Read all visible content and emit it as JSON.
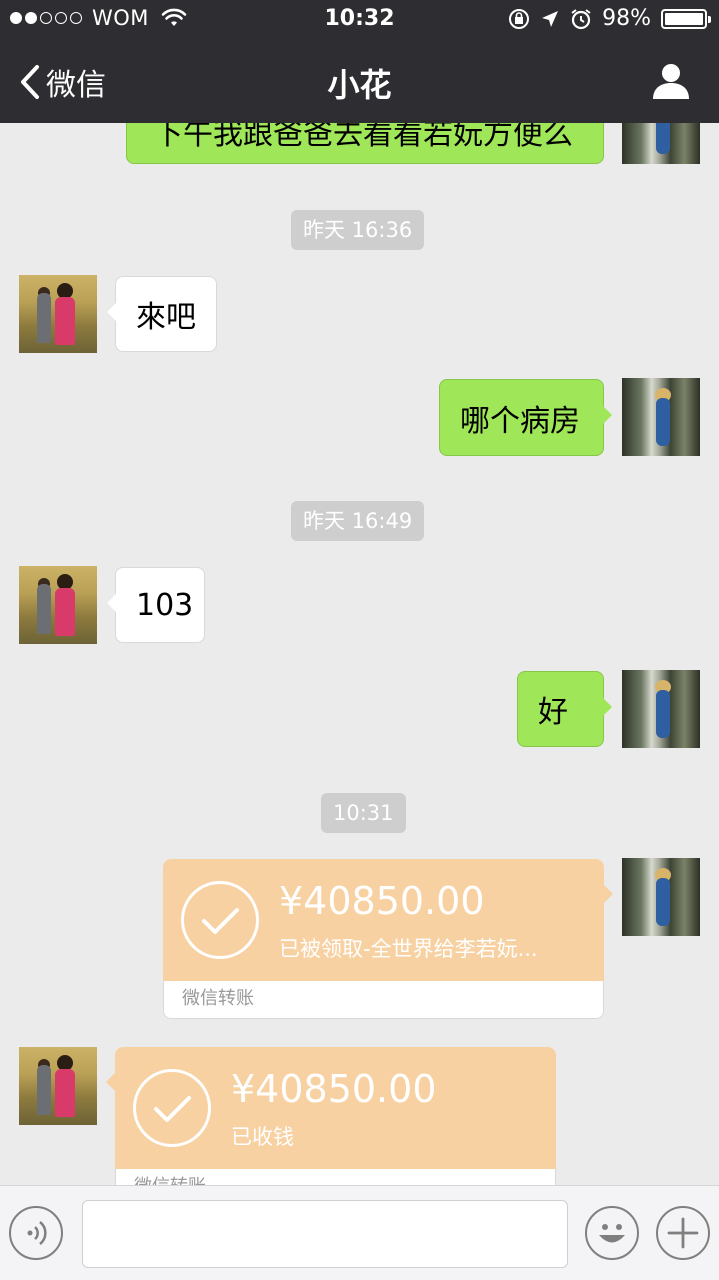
{
  "status_bar": {
    "carrier": "WOM",
    "time": "10:32",
    "battery": "98%"
  },
  "nav": {
    "back_label": "微信",
    "title": "小花"
  },
  "messages": {
    "partial_top": "下午我跟爸爸去看看若妧方便么",
    "ts1": "昨天 16:36",
    "m1": "來吧",
    "m2": "哪个病房",
    "ts2": "昨天 16:49",
    "m3": "103",
    "m4": "好",
    "ts3": "10:31"
  },
  "transfer_out": {
    "amount": "¥40850.00",
    "note": "已被领取-全世界给李若妧...",
    "footer": "微信转账"
  },
  "transfer_in": {
    "amount": "¥40850.00",
    "note": "已收钱",
    "footer": "微信转账"
  },
  "colors": {
    "nav_bg": "#2e2e32",
    "chat_bg": "#ebebeb",
    "bubble_out": "#9fe658",
    "bubble_in": "#ffffff",
    "transfer": "#f8d1a2"
  },
  "icons": [
    "wifi-icon",
    "lock-rotation-icon",
    "location-arrow-icon",
    "alarm-icon",
    "battery-icon",
    "back-chevron-icon",
    "profile-icon",
    "voice-icon",
    "emoji-icon",
    "plus-icon",
    "check-icon"
  ]
}
